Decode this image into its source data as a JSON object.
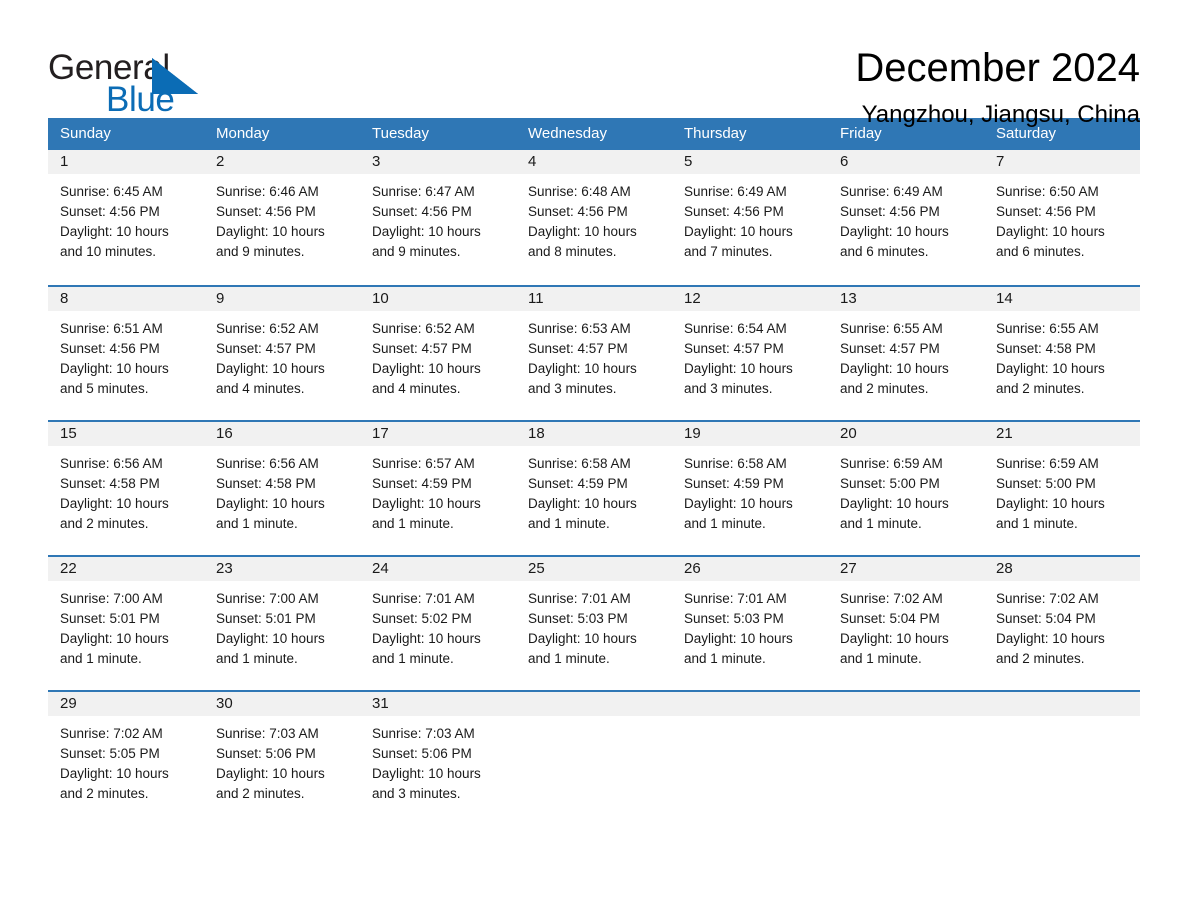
{
  "brand": {
    "name_part1": "General",
    "name_part2": "Blue",
    "logo_icon": "blue-triangle-icon",
    "accent_color": "#0b6cb5"
  },
  "header": {
    "title": "December 2024",
    "location": "Yangzhou, Jiangsu, China"
  },
  "colors": {
    "header_row_bg": "#2f77b5",
    "day_band_bg": "#f1f1f1",
    "row_divider": "#2f77b5",
    "text": "#1a1a1a"
  },
  "weekdays": [
    "Sunday",
    "Monday",
    "Tuesday",
    "Wednesday",
    "Thursday",
    "Friday",
    "Saturday"
  ],
  "labels": {
    "sunrise_prefix": "Sunrise:",
    "sunset_prefix": "Sunset:",
    "daylight_prefix": "Daylight:"
  },
  "weeks": [
    [
      {
        "day": "1",
        "sunrise": "Sunrise: 6:45 AM",
        "sunset": "Sunset: 4:56 PM",
        "daylight_l1": "Daylight: 10 hours",
        "daylight_l2": "and 10 minutes."
      },
      {
        "day": "2",
        "sunrise": "Sunrise: 6:46 AM",
        "sunset": "Sunset: 4:56 PM",
        "daylight_l1": "Daylight: 10 hours",
        "daylight_l2": "and 9 minutes."
      },
      {
        "day": "3",
        "sunrise": "Sunrise: 6:47 AM",
        "sunset": "Sunset: 4:56 PM",
        "daylight_l1": "Daylight: 10 hours",
        "daylight_l2": "and 9 minutes."
      },
      {
        "day": "4",
        "sunrise": "Sunrise: 6:48 AM",
        "sunset": "Sunset: 4:56 PM",
        "daylight_l1": "Daylight: 10 hours",
        "daylight_l2": "and 8 minutes."
      },
      {
        "day": "5",
        "sunrise": "Sunrise: 6:49 AM",
        "sunset": "Sunset: 4:56 PM",
        "daylight_l1": "Daylight: 10 hours",
        "daylight_l2": "and 7 minutes."
      },
      {
        "day": "6",
        "sunrise": "Sunrise: 6:49 AM",
        "sunset": "Sunset: 4:56 PM",
        "daylight_l1": "Daylight: 10 hours",
        "daylight_l2": "and 6 minutes."
      },
      {
        "day": "7",
        "sunrise": "Sunrise: 6:50 AM",
        "sunset": "Sunset: 4:56 PM",
        "daylight_l1": "Daylight: 10 hours",
        "daylight_l2": "and 6 minutes."
      }
    ],
    [
      {
        "day": "8",
        "sunrise": "Sunrise: 6:51 AM",
        "sunset": "Sunset: 4:56 PM",
        "daylight_l1": "Daylight: 10 hours",
        "daylight_l2": "and 5 minutes."
      },
      {
        "day": "9",
        "sunrise": "Sunrise: 6:52 AM",
        "sunset": "Sunset: 4:57 PM",
        "daylight_l1": "Daylight: 10 hours",
        "daylight_l2": "and 4 minutes."
      },
      {
        "day": "10",
        "sunrise": "Sunrise: 6:52 AM",
        "sunset": "Sunset: 4:57 PM",
        "daylight_l1": "Daylight: 10 hours",
        "daylight_l2": "and 4 minutes."
      },
      {
        "day": "11",
        "sunrise": "Sunrise: 6:53 AM",
        "sunset": "Sunset: 4:57 PM",
        "daylight_l1": "Daylight: 10 hours",
        "daylight_l2": "and 3 minutes."
      },
      {
        "day": "12",
        "sunrise": "Sunrise: 6:54 AM",
        "sunset": "Sunset: 4:57 PM",
        "daylight_l1": "Daylight: 10 hours",
        "daylight_l2": "and 3 minutes."
      },
      {
        "day": "13",
        "sunrise": "Sunrise: 6:55 AM",
        "sunset": "Sunset: 4:57 PM",
        "daylight_l1": "Daylight: 10 hours",
        "daylight_l2": "and 2 minutes."
      },
      {
        "day": "14",
        "sunrise": "Sunrise: 6:55 AM",
        "sunset": "Sunset: 4:58 PM",
        "daylight_l1": "Daylight: 10 hours",
        "daylight_l2": "and 2 minutes."
      }
    ],
    [
      {
        "day": "15",
        "sunrise": "Sunrise: 6:56 AM",
        "sunset": "Sunset: 4:58 PM",
        "daylight_l1": "Daylight: 10 hours",
        "daylight_l2": "and 2 minutes."
      },
      {
        "day": "16",
        "sunrise": "Sunrise: 6:56 AM",
        "sunset": "Sunset: 4:58 PM",
        "daylight_l1": "Daylight: 10 hours",
        "daylight_l2": "and 1 minute."
      },
      {
        "day": "17",
        "sunrise": "Sunrise: 6:57 AM",
        "sunset": "Sunset: 4:59 PM",
        "daylight_l1": "Daylight: 10 hours",
        "daylight_l2": "and 1 minute."
      },
      {
        "day": "18",
        "sunrise": "Sunrise: 6:58 AM",
        "sunset": "Sunset: 4:59 PM",
        "daylight_l1": "Daylight: 10 hours",
        "daylight_l2": "and 1 minute."
      },
      {
        "day": "19",
        "sunrise": "Sunrise: 6:58 AM",
        "sunset": "Sunset: 4:59 PM",
        "daylight_l1": "Daylight: 10 hours",
        "daylight_l2": "and 1 minute."
      },
      {
        "day": "20",
        "sunrise": "Sunrise: 6:59 AM",
        "sunset": "Sunset: 5:00 PM",
        "daylight_l1": "Daylight: 10 hours",
        "daylight_l2": "and 1 minute."
      },
      {
        "day": "21",
        "sunrise": "Sunrise: 6:59 AM",
        "sunset": "Sunset: 5:00 PM",
        "daylight_l1": "Daylight: 10 hours",
        "daylight_l2": "and 1 minute."
      }
    ],
    [
      {
        "day": "22",
        "sunrise": "Sunrise: 7:00 AM",
        "sunset": "Sunset: 5:01 PM",
        "daylight_l1": "Daylight: 10 hours",
        "daylight_l2": "and 1 minute."
      },
      {
        "day": "23",
        "sunrise": "Sunrise: 7:00 AM",
        "sunset": "Sunset: 5:01 PM",
        "daylight_l1": "Daylight: 10 hours",
        "daylight_l2": "and 1 minute."
      },
      {
        "day": "24",
        "sunrise": "Sunrise: 7:01 AM",
        "sunset": "Sunset: 5:02 PM",
        "daylight_l1": "Daylight: 10 hours",
        "daylight_l2": "and 1 minute."
      },
      {
        "day": "25",
        "sunrise": "Sunrise: 7:01 AM",
        "sunset": "Sunset: 5:03 PM",
        "daylight_l1": "Daylight: 10 hours",
        "daylight_l2": "and 1 minute."
      },
      {
        "day": "26",
        "sunrise": "Sunrise: 7:01 AM",
        "sunset": "Sunset: 5:03 PM",
        "daylight_l1": "Daylight: 10 hours",
        "daylight_l2": "and 1 minute."
      },
      {
        "day": "27",
        "sunrise": "Sunrise: 7:02 AM",
        "sunset": "Sunset: 5:04 PM",
        "daylight_l1": "Daylight: 10 hours",
        "daylight_l2": "and 1 minute."
      },
      {
        "day": "28",
        "sunrise": "Sunrise: 7:02 AM",
        "sunset": "Sunset: 5:04 PM",
        "daylight_l1": "Daylight: 10 hours",
        "daylight_l2": "and 2 minutes."
      }
    ],
    [
      {
        "day": "29",
        "sunrise": "Sunrise: 7:02 AM",
        "sunset": "Sunset: 5:05 PM",
        "daylight_l1": "Daylight: 10 hours",
        "daylight_l2": "and 2 minutes."
      },
      {
        "day": "30",
        "sunrise": "Sunrise: 7:03 AM",
        "sunset": "Sunset: 5:06 PM",
        "daylight_l1": "Daylight: 10 hours",
        "daylight_l2": "and 2 minutes."
      },
      {
        "day": "31",
        "sunrise": "Sunrise: 7:03 AM",
        "sunset": "Sunset: 5:06 PM",
        "daylight_l1": "Daylight: 10 hours",
        "daylight_l2": "and 3 minutes."
      },
      {
        "day": "",
        "sunrise": "",
        "sunset": "",
        "daylight_l1": "",
        "daylight_l2": ""
      },
      {
        "day": "",
        "sunrise": "",
        "sunset": "",
        "daylight_l1": "",
        "daylight_l2": ""
      },
      {
        "day": "",
        "sunrise": "",
        "sunset": "",
        "daylight_l1": "",
        "daylight_l2": ""
      },
      {
        "day": "",
        "sunrise": "",
        "sunset": "",
        "daylight_l1": "",
        "daylight_l2": ""
      }
    ]
  ]
}
